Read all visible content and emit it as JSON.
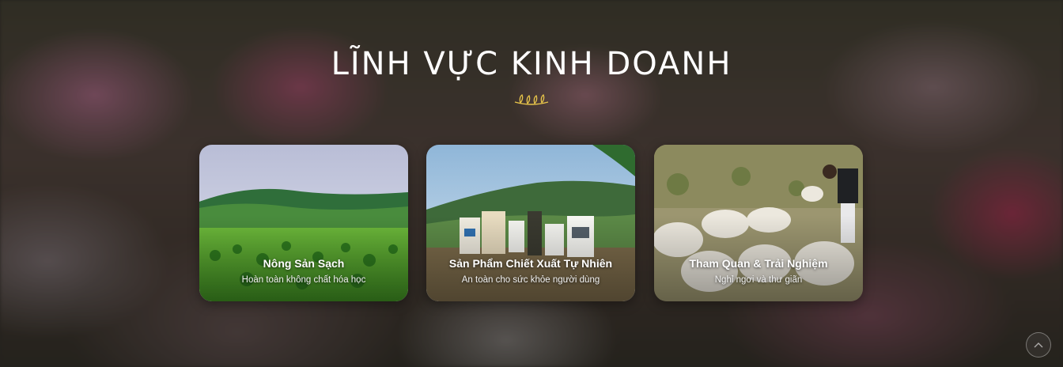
{
  "section": {
    "title": "LĨNH VỰC KINH DOANH"
  },
  "cards": [
    {
      "title": "Nông Sản Sạch",
      "subtitle": "Hoàn toàn không chất hóa học",
      "image": "green-hills-farm"
    },
    {
      "title": "Sản Phẩm Chiết Xuất Tự Nhiên",
      "subtitle": "An toàn cho sức khỏe người dùng",
      "image": "natural-products-bottles"
    },
    {
      "title": "Tham Quan & Trải Nghiệm",
      "subtitle": "Nghỉ ngơi và thư giãn",
      "image": "sheep-farm-visit"
    }
  ],
  "icons": {
    "divider": "leaf-ornament-icon",
    "scroll_top": "chevron-up-icon"
  },
  "colors": {
    "title": "#ffffff",
    "divider": "#e8c54a"
  }
}
